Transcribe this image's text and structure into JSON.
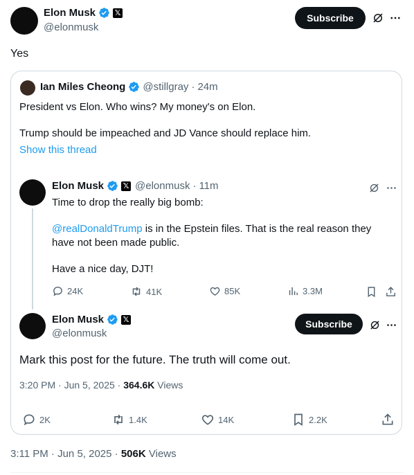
{
  "main_tweet": {
    "author_name": "Elon Musk",
    "author_handle": "@elonmusk",
    "subscribe_label": "Subscribe",
    "text": "Yes",
    "time": "3:11 PM",
    "date": "Jun 5, 2025",
    "views_count": "506K",
    "views_label": "Views"
  },
  "quoted": {
    "author_name": "Ian Miles Cheong",
    "author_handle": "@stillgray",
    "elapsed": "24m",
    "line1": "President vs Elon. Who wins? My money's on Elon.",
    "line2": "Trump should be impeached and JD Vance should replace him.",
    "show_thread": "Show this thread"
  },
  "thread_tweet_1": {
    "author_name": "Elon Musk",
    "author_handle": "@elonmusk",
    "elapsed": "11m",
    "line1": "Time to drop the really big bomb:",
    "mention": "@realDonaldTrump",
    "line2_rest": " is in the Epstein files. That is the real reason they have not been made public.",
    "line3": "Have a nice day, DJT!",
    "replies": "24K",
    "reposts": "41K",
    "likes": "85K",
    "views": "3.3M"
  },
  "thread_tweet_2": {
    "author_name": "Elon Musk",
    "author_handle": "@elonmusk",
    "subscribe_label": "Subscribe",
    "text": "Mark this post for the future. The truth will come out.",
    "time": "3:20 PM",
    "date": "Jun 5, 2025",
    "views_count": "364.6K",
    "views_label": "Views",
    "replies": "2K",
    "reposts": "1.4K",
    "likes": "14K",
    "bookmarks": "2.2K"
  },
  "colors": {
    "accent": "#1d9bf0",
    "text": "#0f1419",
    "muted": "#536471",
    "border": "#cfd9de"
  },
  "icons": [
    "verified-badge-icon",
    "x-logo-icon",
    "grok-icon",
    "more-icon",
    "reply-icon",
    "repost-icon",
    "like-icon",
    "views-icon",
    "bookmark-icon",
    "share-icon"
  ]
}
